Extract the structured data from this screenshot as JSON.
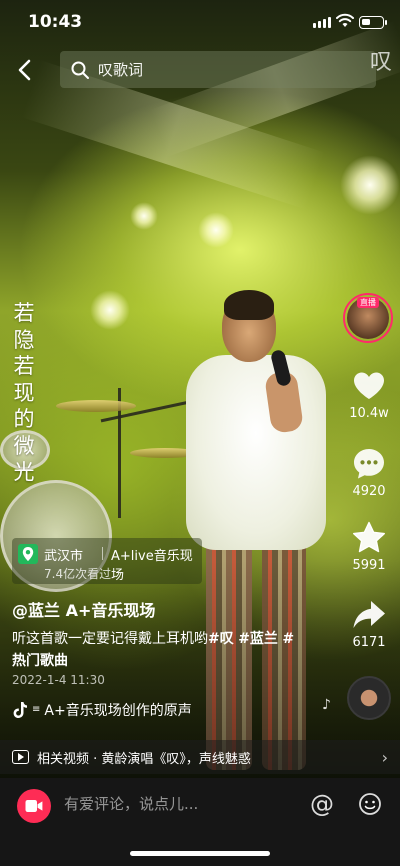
{
  "status_bar": {
    "time": "10:43",
    "battery_level": 0.4
  },
  "search": {
    "placeholder": "叹歌词",
    "deco_char": "叹"
  },
  "vertical_lyric": [
    "若",
    "隐",
    "若",
    "现",
    "的",
    "微",
    "光"
  ],
  "location": {
    "city": "武汉市",
    "venue": "A+live音乐现场",
    "views": "7.4亿次看过"
  },
  "caption": {
    "author": "@蓝兰 A+音乐现场",
    "text": "听这首歌一定要记得戴上耳机哟",
    "tag_1": "#叹",
    "tag_2": "#蓝兰",
    "tag_3": "#热门歌曲",
    "date": "2022-1-4 11:30"
  },
  "music": {
    "label": "A+音乐现场创作的原声"
  },
  "rail": {
    "live_tag": "直播",
    "likes": "10.4w",
    "comments": "4920",
    "favorites": "5991",
    "shares": "6171"
  },
  "related": {
    "text": "相关视频 · 黄龄演唱《叹》，声线魅惑"
  },
  "comment_bar": {
    "placeholder": "有爱评论，说点儿...",
    "at_symbol": "@"
  },
  "colors": {
    "accent": "#fe2c55",
    "live_ring": "#ff2a6a",
    "location_green": "#23b85b"
  }
}
